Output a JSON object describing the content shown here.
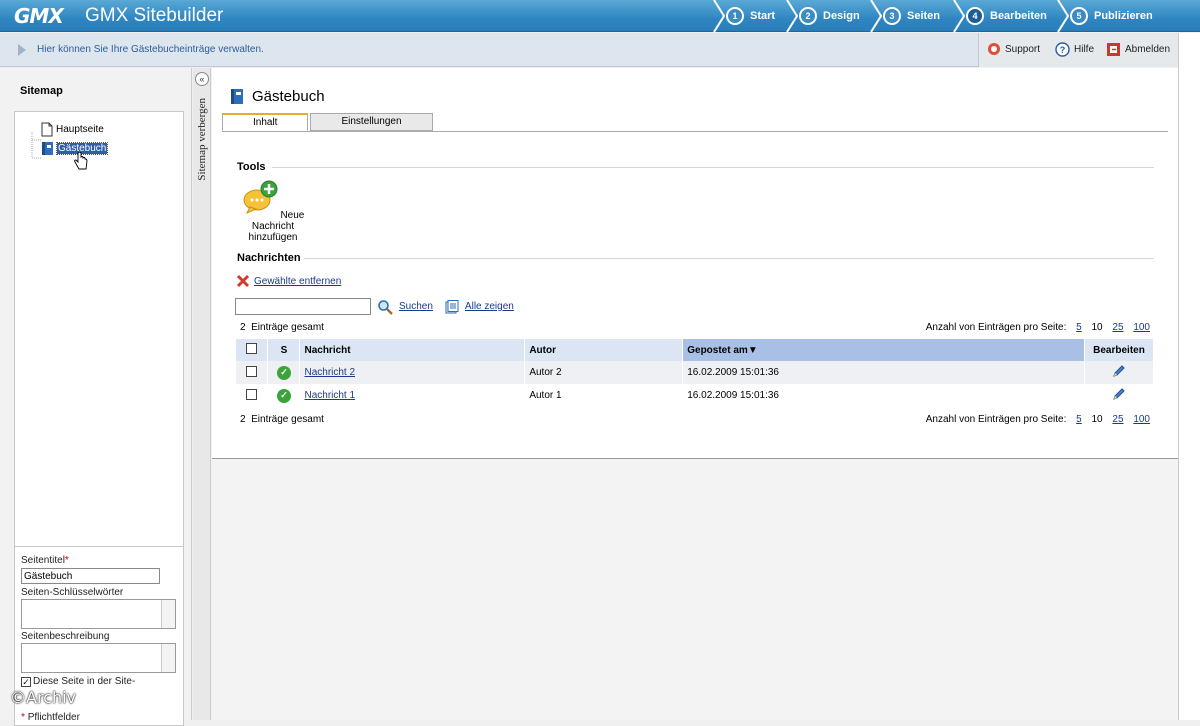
{
  "app": {
    "logo": "GMX",
    "title": "GMX Sitebuilder"
  },
  "steps": [
    {
      "num": "1",
      "label": "Start"
    },
    {
      "num": "2",
      "label": "Design"
    },
    {
      "num": "3",
      "label": "Seiten"
    },
    {
      "num": "4",
      "label": "Bearbeiten",
      "active": true
    },
    {
      "num": "5",
      "label": "Publizieren"
    }
  ],
  "infobar": {
    "text": "Hier können Sie Ihre Gästebucheinträge verwalten.",
    "support": "Support",
    "help": "Hilfe",
    "logout": "Abmelden"
  },
  "sidebar": {
    "title": "Sitemap",
    "hide_label": "Sitemap verbergen",
    "tree": [
      {
        "label": "Hauptseite"
      },
      {
        "label": "Gästebuch",
        "selected": true
      }
    ],
    "props": {
      "title_label": "Seitentitel",
      "required_mark": "*",
      "title_value": "Gästebuch",
      "keywords_label": "Seiten-Schlüsselwörter",
      "description_label": "Seitenbeschreibung",
      "show_in_sitemap_label": "Diese Seite in der Site-",
      "required_note": "Pflichtfelder"
    }
  },
  "page": {
    "title": "Gästebuch",
    "tabs": [
      "Inhalt",
      "Einstellungen"
    ],
    "tools_title": "Tools",
    "new_message": "Neue Nachricht hinzufügen",
    "messages_title": "Nachrichten",
    "remove_selected": "Gewählte entfernen",
    "search_label": "Suchen",
    "show_all_label": "Alle zeigen",
    "total_count": "2",
    "total_label": "Einträge gesamt",
    "per_page_label": "Anzahl von Einträgen pro Seite:",
    "per_page_options": [
      "5",
      "10",
      "25",
      "100"
    ],
    "per_page_current": "10",
    "columns": [
      "S",
      "Nachricht",
      "Autor",
      "Gepostet am",
      "Bearbeiten"
    ],
    "rows": [
      {
        "message": "Nachricht 2",
        "author": "Autor 2",
        "posted": "16.02.2009 15:01:36"
      },
      {
        "message": "Nachricht 1",
        "author": "Autor 1",
        "posted": "16.02.2009 15:01:36"
      }
    ]
  },
  "watermark": "©Archiv",
  "colors": {
    "header": "#2f86c1",
    "selection": "#2f5ea8",
    "link": "#1a3a8c",
    "status_ok": "#3aa33a"
  }
}
